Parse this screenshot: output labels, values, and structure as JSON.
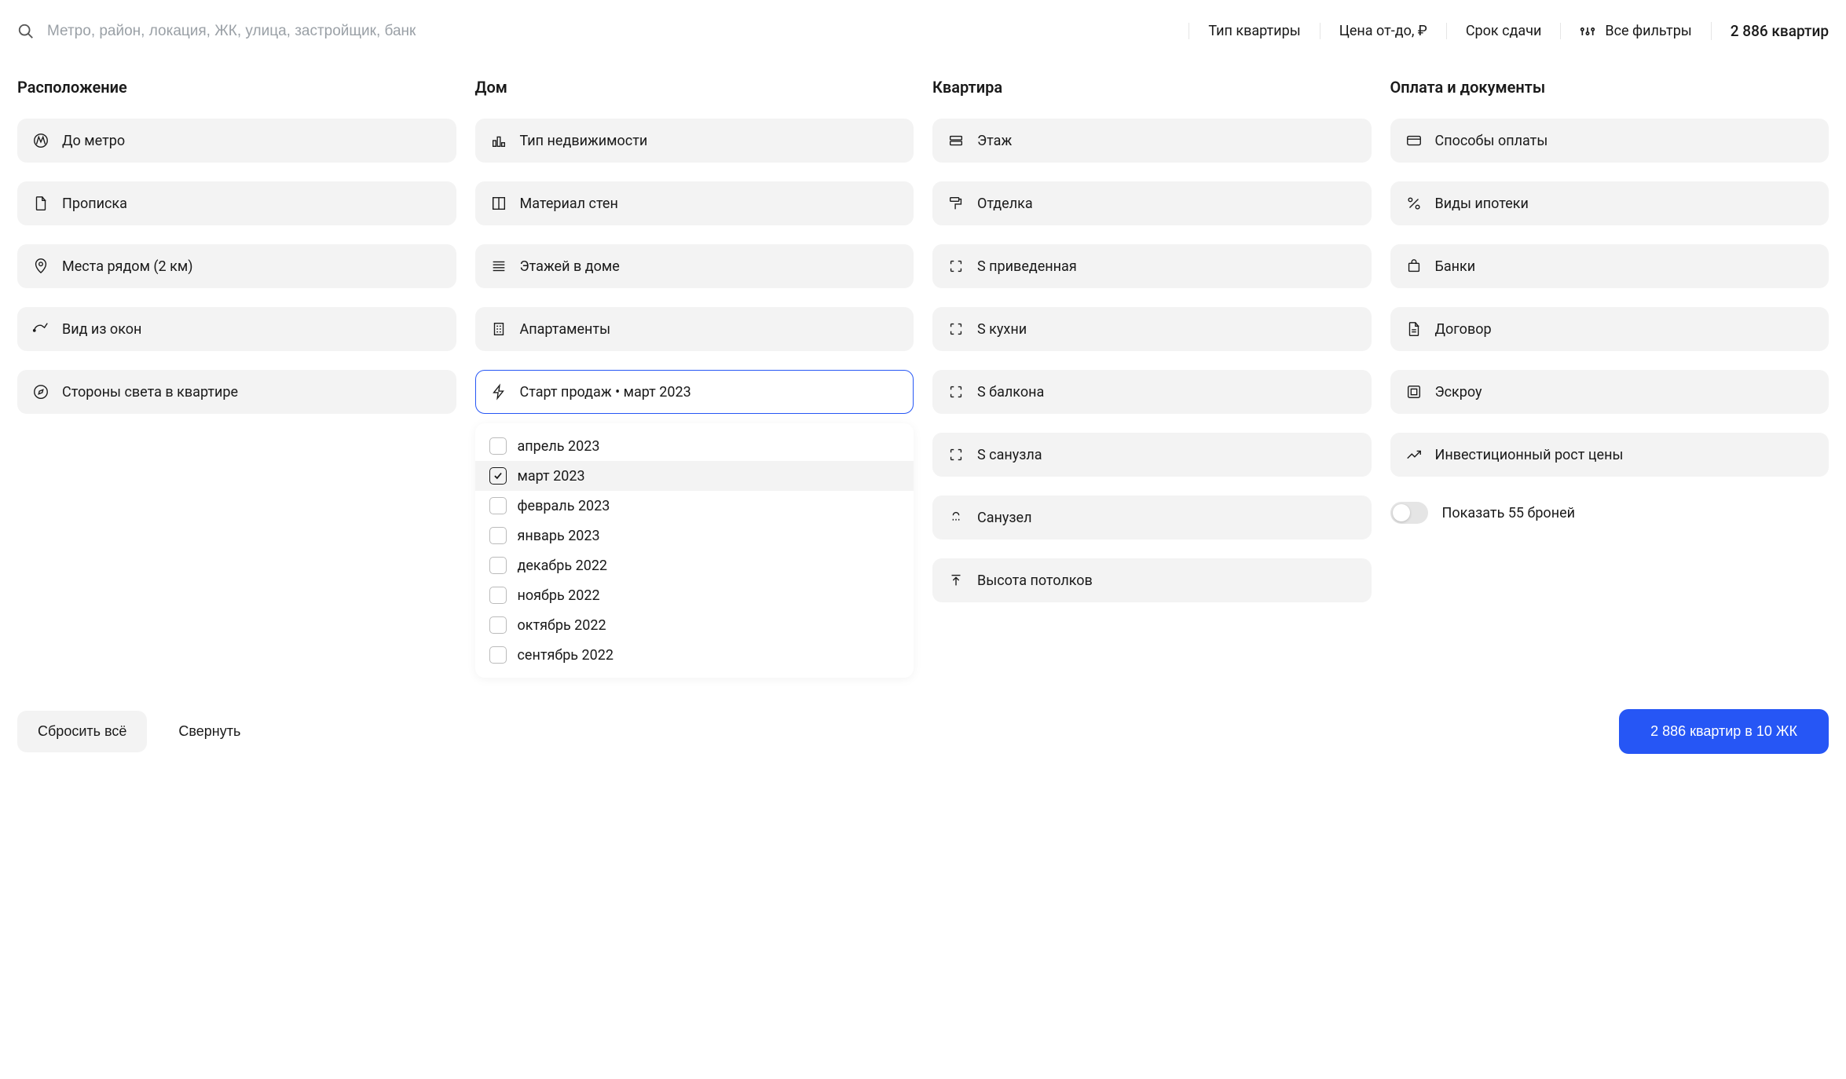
{
  "search": {
    "placeholder": "Метро, район, локация, ЖК, улица, застройщик, банк"
  },
  "topFilters": {
    "type": "Тип квартиры",
    "price": "Цена от-до, ₽",
    "deadline": "Срок сдачи",
    "all": "Все фильтры"
  },
  "resultsCount": "2 886 квартир",
  "columns": {
    "location": {
      "title": "Расположение",
      "metro": "До метро",
      "registration": "Прописка",
      "nearby": "Места рядом (2 км)",
      "windowView": "Вид из окон",
      "cardinal": "Стороны света в квартире"
    },
    "house": {
      "title": "Дом",
      "propertyType": "Тип недвижимости",
      "wallMaterial": "Материал стен",
      "floors": "Этажей в доме",
      "apartments": "Апартаменты",
      "salesStart": "Старт продаж • март 2023"
    },
    "apartment": {
      "title": "Квартира",
      "floor": "Этаж",
      "finishing": "Отделка",
      "areaReduced": "S приведенная",
      "kitchenArea": "S кухни",
      "balconyArea": "S балкона",
      "bathroomArea": "S санузла",
      "bathroom": "Санузел",
      "ceilingHeight": "Высота потолков"
    },
    "payment": {
      "title": "Оплата и документы",
      "methods": "Способы оплаты",
      "mortgageTypes": "Виды ипотеки",
      "banks": "Банки",
      "contract": "Договор",
      "escrow": "Эскроу",
      "priceGrowth": "Инвестиционный рост цены",
      "showReserved": "Показать 55 броней"
    }
  },
  "salesStartOptions": {
    "apr2023": "апрель 2023",
    "mar2023": "март 2023",
    "feb2023": "февраль 2023",
    "jan2023": "январь 2023",
    "dec2022": "декабрь 2022",
    "nov2022": "ноябрь 2022",
    "oct2022": "октябрь 2022",
    "sep2022": "сентябрь 2022"
  },
  "footer": {
    "reset": "Сбросить всё",
    "collapse": "Свернуть",
    "submit": "2 886 квартир в 10 ЖК"
  }
}
